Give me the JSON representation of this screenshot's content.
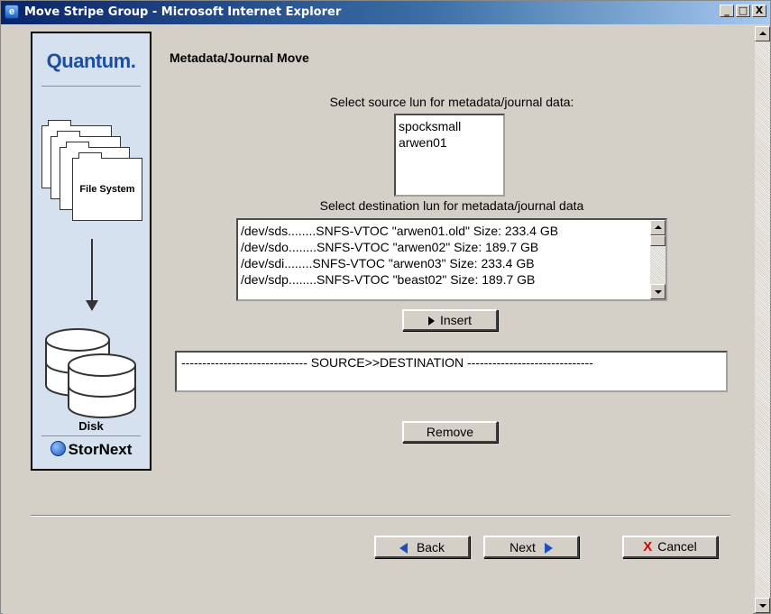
{
  "window": {
    "title": "Move Stripe Group - Microsoft Internet Explorer",
    "minimize": "_",
    "maximize": "□",
    "close": "X"
  },
  "sidebar": {
    "brand": "Quantum.",
    "file_system_label": "File System",
    "disk_label": "Disk",
    "footer_brand": "StorNext"
  },
  "page": {
    "title": "Metadata/Journal Move",
    "source_prompt": "Select source lun for metadata/journal data:",
    "destination_prompt": "Select destination lun for metadata/journal data"
  },
  "source_luns": [
    "spocksmall",
    "arwen01"
  ],
  "destination_luns": [
    "/dev/sds........SNFS-VTOC \"arwen01.old\" Size: 233.4 GB",
    "/dev/sdo........SNFS-VTOC \"arwen02\" Size: 189.7 GB",
    "/dev/sdi........SNFS-VTOC \"arwen03\" Size: 233.4 GB",
    "/dev/sdp........SNFS-VTOC \"beast02\" Size: 189.7 GB"
  ],
  "buttons": {
    "insert": "Insert",
    "remove": "Remove",
    "back": "Back",
    "next": "Next",
    "cancel": "Cancel"
  },
  "mapping_box": {
    "header": "------------------------------ SOURCE>>DESTINATION ------------------------------"
  },
  "colors": {
    "titlebar_start": "#0a246a",
    "sidebar_bg": "#d6e1ef",
    "brand_blue": "#1d4ea2",
    "nav_arrow": "#1c4fbe",
    "cancel_x": "#dd0000"
  }
}
